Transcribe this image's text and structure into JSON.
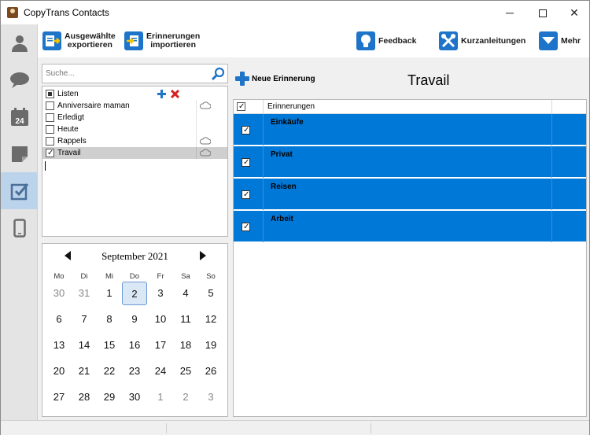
{
  "window": {
    "title": "CopyTrans Contacts"
  },
  "toolbar": {
    "export_label_1": "Ausgewählte",
    "export_label_2": "exportieren",
    "import_label_1": "Erinnerungen",
    "import_label_2": "importieren",
    "feedback_label": "Feedback",
    "guides_label": "Kurzanleitungen",
    "more_label": "Mehr"
  },
  "search": {
    "placeholder": "Suche..."
  },
  "lists": {
    "header": "Listen",
    "items": [
      {
        "label": "Anniversaire maman",
        "checked": false,
        "cloud": true
      },
      {
        "label": "Erledigt",
        "checked": false,
        "cloud": false
      },
      {
        "label": "Heute",
        "checked": false,
        "cloud": false
      },
      {
        "label": "Rappels",
        "checked": false,
        "cloud": true
      },
      {
        "label": "Travail",
        "checked": true,
        "cloud": true,
        "selected": true
      }
    ]
  },
  "calendar": {
    "month_label": "September 2021",
    "weekdays": [
      "Mo",
      "Di",
      "Mi",
      "Do",
      "Fr",
      "Sa",
      "So"
    ],
    "weeks": [
      [
        "30",
        "31",
        "1",
        "2",
        "3",
        "4",
        "5"
      ],
      [
        "6",
        "7",
        "8",
        "9",
        "10",
        "11",
        "12"
      ],
      [
        "13",
        "14",
        "15",
        "16",
        "17",
        "18",
        "19"
      ],
      [
        "20",
        "21",
        "22",
        "23",
        "24",
        "25",
        "26"
      ],
      [
        "27",
        "28",
        "29",
        "30",
        "1",
        "2",
        "3"
      ]
    ],
    "today": "2"
  },
  "reminders": {
    "new_label": "Neue Erinnerung",
    "list_title": "Travail",
    "column_header": "Erinnerungen",
    "items": [
      {
        "label": "Einkäufe",
        "checked": true
      },
      {
        "label": "Privat",
        "checked": true
      },
      {
        "label": "Reisen",
        "checked": true
      },
      {
        "label": "Arbeit",
        "checked": true
      }
    ]
  },
  "colors": {
    "accent": "#1e74c8",
    "selection": "#0078d7",
    "nav_active": "#bcd3ec"
  }
}
